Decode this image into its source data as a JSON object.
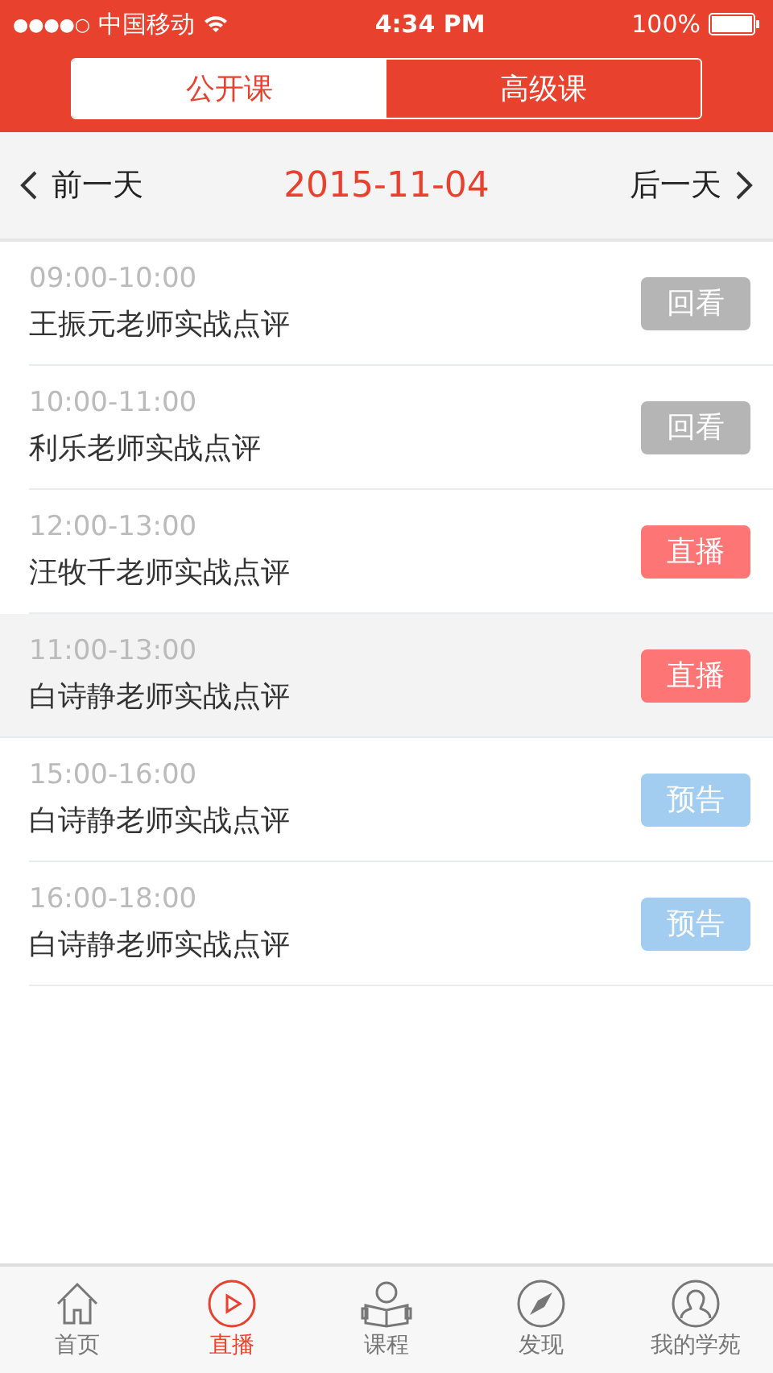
{
  "status_bar": {
    "signal_text": "●●●●○",
    "carrier": "中国移动",
    "time": "4:34 PM",
    "battery": "100%"
  },
  "tabs": [
    {
      "label": "公开课",
      "selected": true
    },
    {
      "label": "高级课",
      "selected": false
    }
  ],
  "date_nav": {
    "prev": "前一天",
    "date": "2015-11-04",
    "next": "后一天"
  },
  "sessions": [
    {
      "time": "09:00-10:00",
      "title": "王振元老师实战点评",
      "status": "回看",
      "kind": "replay",
      "selected": false
    },
    {
      "time": "10:00-11:00",
      "title": "利乐老师实战点评",
      "status": "回看",
      "kind": "replay",
      "selected": false
    },
    {
      "time": "12:00-13:00",
      "title": "汪牧千老师实战点评",
      "status": "直播",
      "kind": "live",
      "selected": false
    },
    {
      "time": "11:00-13:00",
      "title": "白诗静老师实战点评",
      "status": "直播",
      "kind": "live",
      "selected": true
    },
    {
      "time": "15:00-16:00",
      "title": "白诗静老师实战点评",
      "status": "预告",
      "kind": "preview",
      "selected": false
    },
    {
      "time": "16:00-18:00",
      "title": "白诗静老师实战点评",
      "status": "预告",
      "kind": "preview",
      "selected": false
    }
  ],
  "tab_bar": [
    {
      "label": "首页",
      "kind": "home",
      "selected": false
    },
    {
      "label": "直播",
      "kind": "live",
      "selected": true
    },
    {
      "label": "课程",
      "kind": "courses",
      "selected": false
    },
    {
      "label": "发现",
      "kind": "discover",
      "selected": false
    },
    {
      "label": "我的学苑",
      "kind": "profile",
      "selected": false
    }
  ]
}
